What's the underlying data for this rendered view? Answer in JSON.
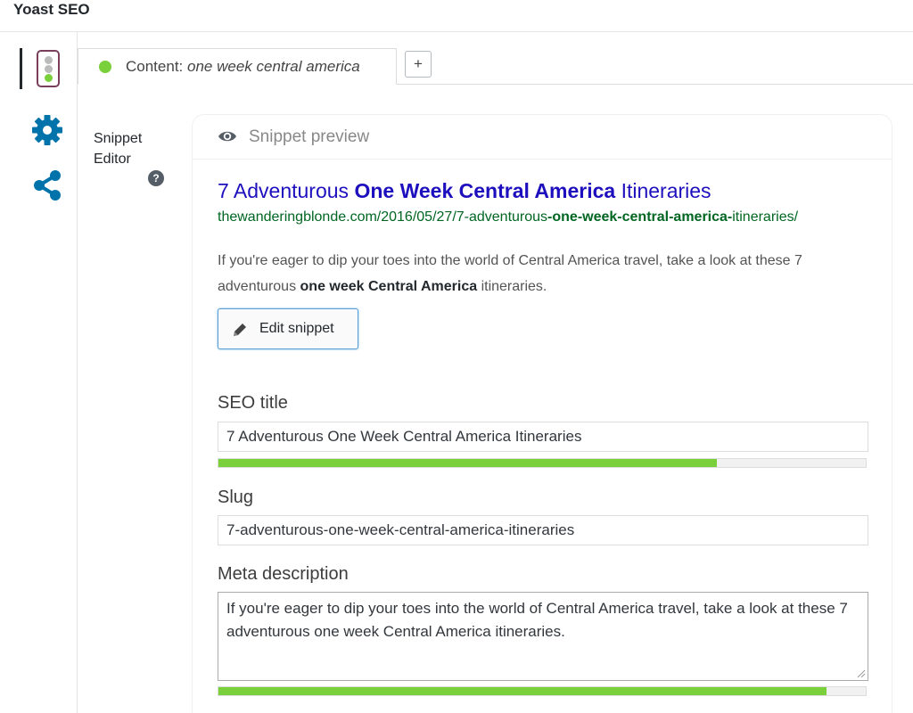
{
  "header": {
    "title": "Yoast SEO"
  },
  "side_tabs": [
    {
      "name": "readability-traffic-light",
      "active": true
    },
    {
      "name": "settings"
    },
    {
      "name": "social"
    }
  ],
  "tabs": {
    "content_prefix": "Content: ",
    "content_keyword": "one week central america",
    "add_label": "+",
    "status_color": "#7ad03a"
  },
  "snippet_editor": {
    "label": "Snippet Editor",
    "help_label": "?"
  },
  "preview": {
    "heading": "Snippet preview",
    "title_before": "7 Adventurous ",
    "title_bold": "One Week Central America",
    "title_after": " Itineraries",
    "url_before": "thewanderingblonde.com/2016/05/27/7-adventurous",
    "url_bold": "-one-week-central-america-",
    "url_after": "itineraries/",
    "desc_before": "If you're eager to dip your toes into the world of Central America travel, take a look at these 7 adventurous ",
    "desc_bold": "one week Central America",
    "desc_after": " itineraries.",
    "edit_label": "Edit snippet"
  },
  "fields": {
    "seo_title": {
      "label": "SEO title",
      "value": "7 Adventurous One Week Central America Itineraries",
      "progress": 0.77
    },
    "slug": {
      "label": "Slug",
      "value": "7-adventurous-one-week-central-america-itineraries"
    },
    "meta_description": {
      "label": "Meta description",
      "value": "If you're eager to dip your toes into the world of Central America travel, take a look at these 7 adventurous one week Central America itineraries.",
      "progress": 0.94
    }
  },
  "colors": {
    "link_blue": "#1e0fbe",
    "url_green": "#006621",
    "good_green": "#7ad03a",
    "icon_blue": "#0073aa"
  }
}
